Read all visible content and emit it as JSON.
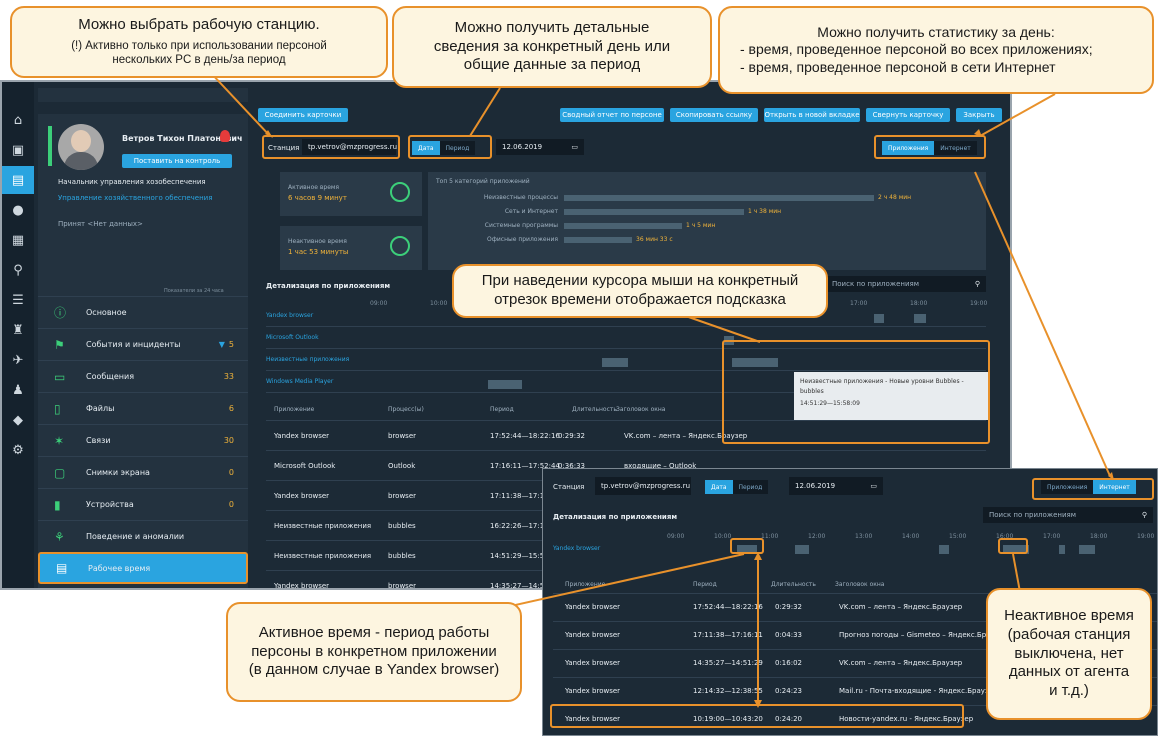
{
  "callouts": {
    "station": {
      "line1": "Можно выбрать рабочую станцию.",
      "line2": "(!) Активно только при использовании персоной",
      "line3": "нескольких PC в день/за период"
    },
    "period": {
      "line1": "Можно получить детальные",
      "line2": "сведения за конкретный день или",
      "line3": "общие данные за период"
    },
    "stats": {
      "line1": "Можно получить статистику за день:",
      "line2": "- время, проведенное персоной во всех приложениях;",
      "line3": "- время, проведенное персоной в сети Интернет"
    },
    "hover": {
      "line1": "При наведении курсора мыши на конкретный",
      "line2": "отрезок времени отображается подсказка"
    },
    "active": {
      "line1": "Активное время - период работы",
      "line2": "персоны в конкретном приложении",
      "line3": "(в данном случае в Yandex browser)"
    },
    "inactive": {
      "line1": "Неактивное время",
      "line2": "(рабочая станция",
      "line3": "выключена, нет",
      "line4": "данных от агента",
      "line5": "и т.д.)"
    }
  },
  "toolbar": {
    "connect_cards": "Соединить карточки",
    "summary_report": "Сводный отчет по персоне",
    "copy_link": "Скопировать ссылку",
    "open_new_tab": "Открыть в новой вкладке",
    "collapse_card": "Свернуть карточку",
    "close": "Закрыть"
  },
  "profile": {
    "name": "Ветров Тихон Платонович",
    "monitor_button": "Поставить на контроль",
    "position": "Начальник управления хозобеспечения",
    "department": "Управление хозяйственного обеспечения",
    "accepted": "Принят <Нет данных>",
    "shown_for": "Показатели за 24 часа"
  },
  "menu": [
    {
      "label": "Основное",
      "count": "",
      "icon": "info-icon"
    },
    {
      "label": "События и инциденты",
      "count": "5",
      "icon": "events-icon"
    },
    {
      "label": "Сообщения",
      "count": "33",
      "icon": "messages-icon"
    },
    {
      "label": "Файлы",
      "count": "6",
      "icon": "files-icon"
    },
    {
      "label": "Связи",
      "count": "30",
      "icon": "links-icon"
    },
    {
      "label": "Снимки экрана",
      "count": "0",
      "icon": "screenshot-icon"
    },
    {
      "label": "Устройства",
      "count": "0",
      "icon": "devices-icon"
    },
    {
      "label": "Поведение и аномалии",
      "count": "",
      "icon": "behavior-icon"
    },
    {
      "label": "Рабочее время",
      "count": "",
      "icon": "clock-icon"
    }
  ],
  "filters": {
    "station_label": "Станция",
    "station_value": "tp.vetrov@mzprogress.ru",
    "tab_date": "Дата",
    "tab_period": "Период",
    "date_value": "12.06.2019",
    "tab_apps": "Приложения",
    "tab_internet": "Интернет"
  },
  "stats": {
    "active_label": "Активное время",
    "active_value": "6 часов 9 минут",
    "inactive_label": "Неактивное время",
    "inactive_value": "1 час 53 минуты",
    "top_label": "Топ 5 категорий приложений",
    "categories": [
      {
        "name": "Неизвестные процессы",
        "value": "2 ч 48 мин",
        "fraction": 1.0
      },
      {
        "name": "Сеть и Интернет",
        "value": "1 ч 38 мин",
        "fraction": 0.58
      },
      {
        "name": "Системные программы",
        "value": "1 ч 5 мин",
        "fraction": 0.38
      },
      {
        "name": "Офисные приложения",
        "value": "36 мин 33 с",
        "fraction": 0.22
      }
    ]
  },
  "detail": {
    "title": "Детализация по приложениям",
    "search_placeholder": "Поиск по приложениям",
    "hours": [
      "09:00",
      "10:00",
      "11:00",
      "12:00",
      "13:00",
      "14:00",
      "15:00",
      "16:00",
      "17:00",
      "18:00",
      "19:00"
    ],
    "app_rows": [
      "Yandex browser",
      "Microsoft Outlook",
      "Неизвестные приложения",
      "Windows Media Player"
    ],
    "tooltip": {
      "line1": "Неизвестные приложения - Новые уровни Bubbles -",
      "line2": "bubbles",
      "line3": "14:51:29—15:58:09"
    },
    "columns": [
      "Приложение",
      "Процесс(ы)",
      "Период",
      "Длительность",
      "Заголовок окна"
    ],
    "rows": [
      {
        "app": "Yandex browser",
        "process": "browser",
        "period": "17:52:44—18:22:16",
        "duration": "0:29:32",
        "title": "VK.com – лента – Яндекс.Браузер"
      },
      {
        "app": "Microsoft Outlook",
        "process": "Outlook",
        "period": "17:16:11—17:52:44",
        "duration": "0:36:33",
        "title": "входящие – Outlook"
      },
      {
        "app": "Yandex browser",
        "process": "browser",
        "period": "17:11:38—17:16:11",
        "duration": "",
        "title": ""
      },
      {
        "app": "Неизвестные приложения",
        "process": "bubbles",
        "period": "16:22:26—17:11:38",
        "duration": "",
        "title": ""
      },
      {
        "app": "Неизвестные приложения",
        "process": "bubbles",
        "period": "14:51:29—15:58:09",
        "duration": "",
        "title": ""
      },
      {
        "app": "Yandex browser",
        "process": "browser",
        "period": "14:35:27—14:51:29",
        "duration": "",
        "title": ""
      }
    ]
  },
  "popup": {
    "station_label": "Станция",
    "station_value": "tp.vetrov@mzprogress.ru",
    "tab_date": "Дата",
    "tab_period": "Период",
    "date_value": "12.06.2019",
    "tab_apps": "Приложения",
    "tab_internet": "Интернет",
    "title": "Детализация по приложениям",
    "search_placeholder": "Поиск по приложениям",
    "hours": [
      "09:00",
      "10:00",
      "11:00",
      "12:00",
      "13:00",
      "14:00",
      "15:00",
      "16:00",
      "17:00",
      "18:00",
      "19:00"
    ],
    "app_row": "Yandex browser",
    "columns": [
      "Приложение",
      "Период",
      "Длительность",
      "Заголовок окна"
    ],
    "rows": [
      {
        "app": "Yandex browser",
        "period": "17:52:44—18:22:16",
        "duration": "0:29:32",
        "title": "VK.com – лента – Яндекс.Браузер"
      },
      {
        "app": "Yandex browser",
        "period": "17:11:38—17:16:11",
        "duration": "0:04:33",
        "title": "Прогноз погоды – Gismeteo – Яндекс.Браузер"
      },
      {
        "app": "Yandex browser",
        "period": "14:35:27—14:51:29",
        "duration": "0:16:02",
        "title": "VK.com – лента – Яндекс.Браузер"
      },
      {
        "app": "Yandex browser",
        "period": "12:14:32—12:38:55",
        "duration": "0:24:23",
        "title": "Mail.ru - Почта-входящие - Яндекс.Браузер"
      },
      {
        "app": "Yandex browser",
        "period": "10:19:00—10:43:20",
        "duration": "0:24:20",
        "title": "Новости-yandex.ru - Яндекс.Браузер"
      }
    ]
  },
  "colors": {
    "accent": "#2aa4e0",
    "highlight": "#e8912b",
    "value": "#f0b33a",
    "panel": "#1c2a36"
  }
}
